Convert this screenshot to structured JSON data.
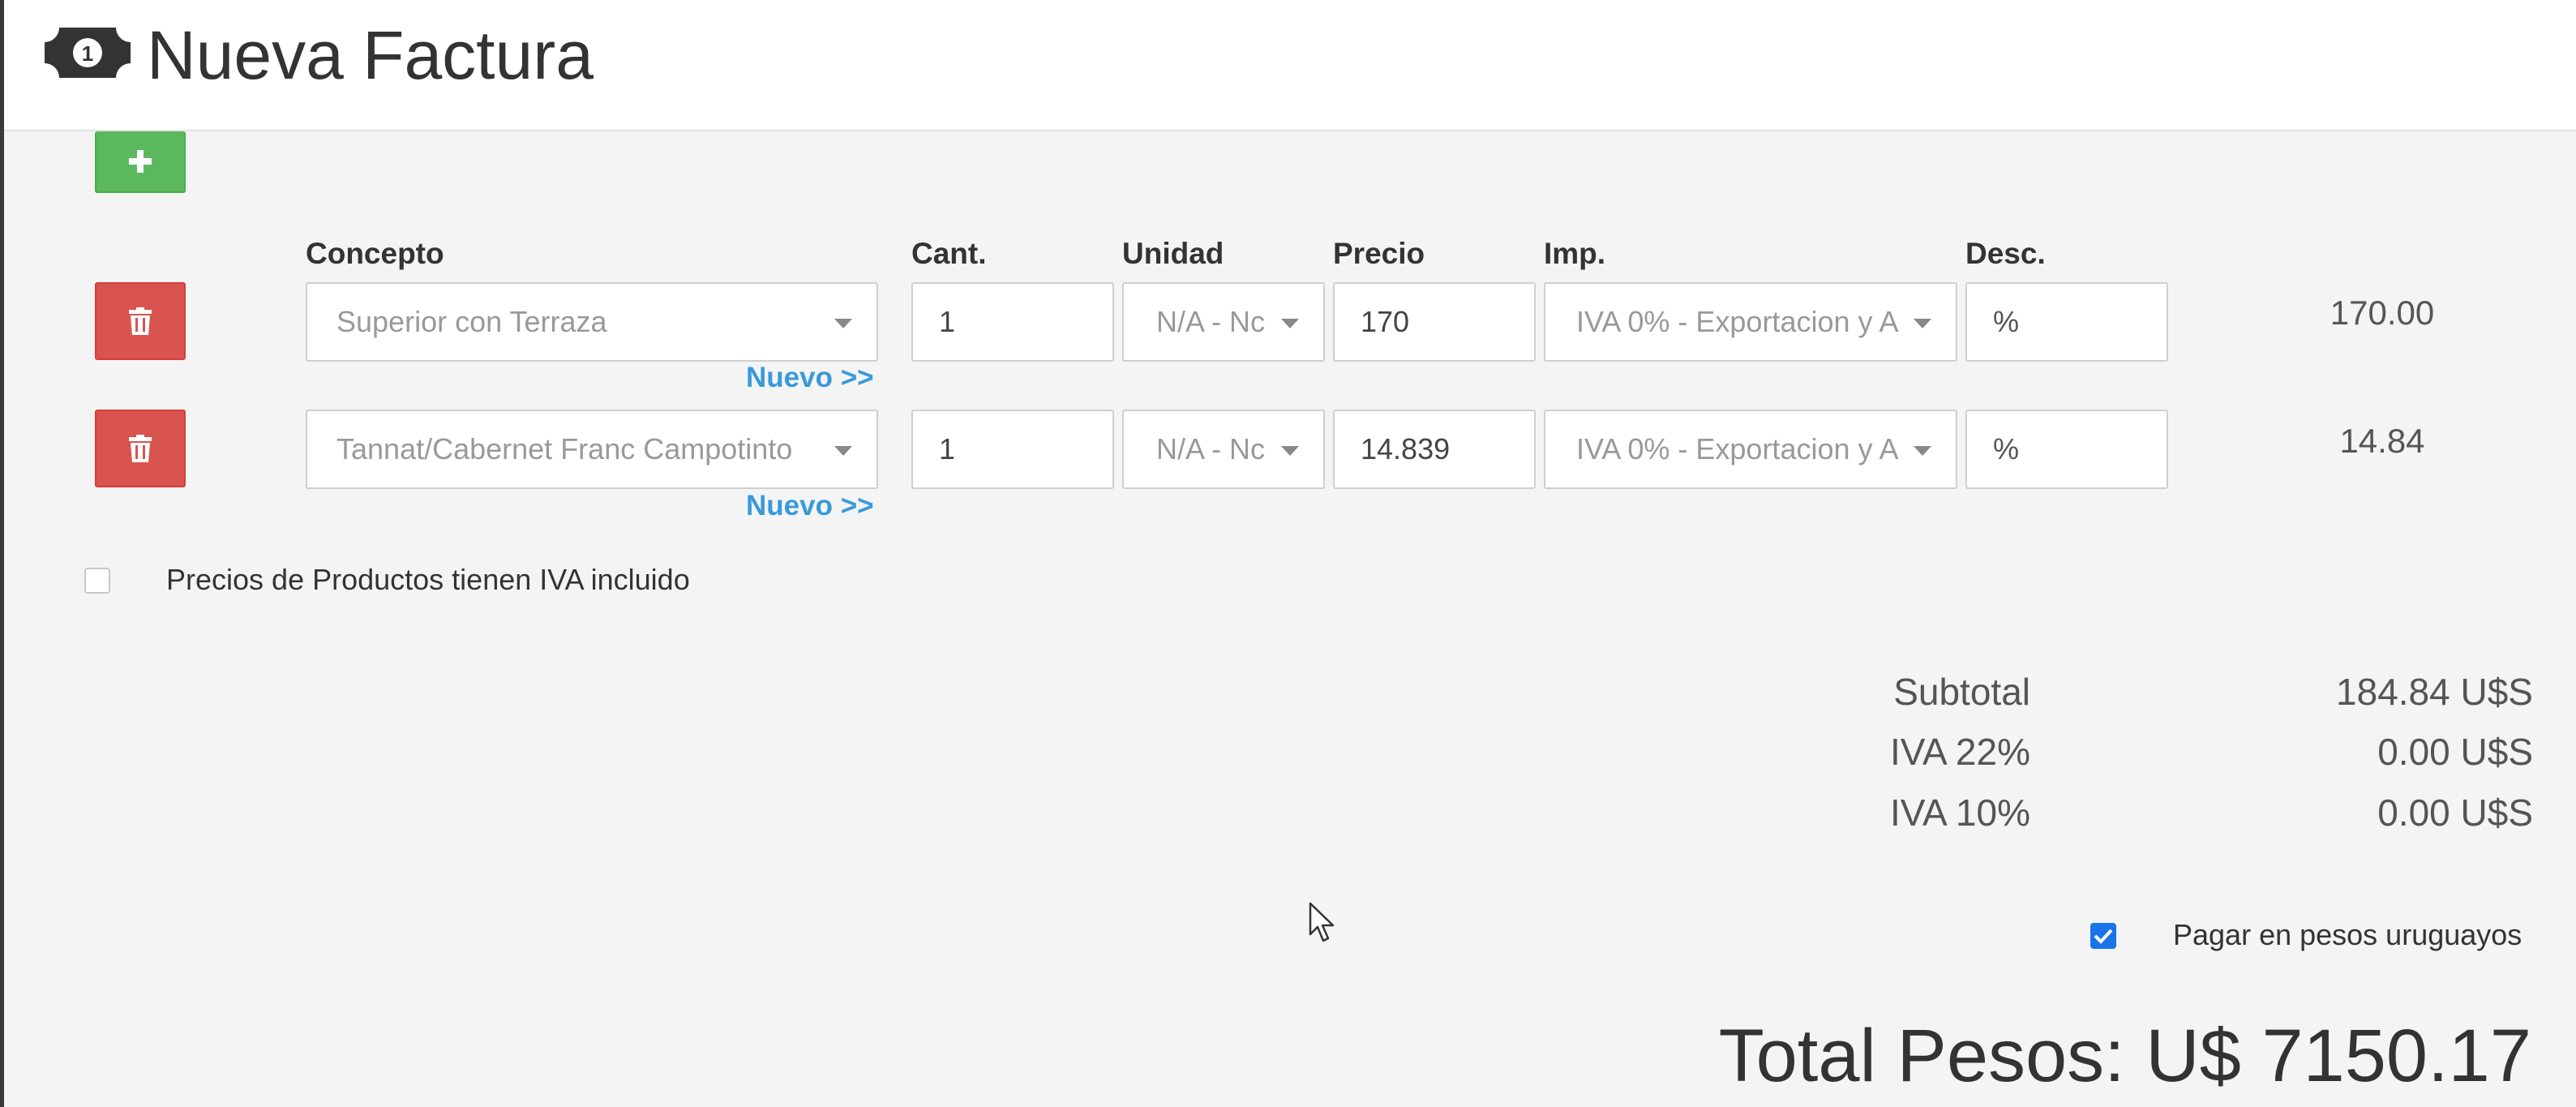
{
  "header": {
    "title": "Nueva Factura",
    "icon": "money-bill-icon"
  },
  "columns": {
    "concepto": "Concepto",
    "cantidad": "Cant.",
    "unidad": "Unidad",
    "precio": "Precio",
    "impuesto": "Imp.",
    "descuento": "Desc."
  },
  "lines": [
    {
      "concepto": "Superior con Terraza",
      "cantidad": "1",
      "unidad": "N/A - Nc",
      "precio": "170",
      "impuesto": "IVA 0% - Exportacion y A",
      "descuento": "%",
      "nuevo_link": "Nuevo >>",
      "total": "170.00"
    },
    {
      "concepto": "Tannat/Cabernet Franc Campotinto",
      "cantidad": "1",
      "unidad": "N/A - Nc",
      "precio": "14.839",
      "impuesto": "IVA 0% - Exportacion y A",
      "descuento": "%",
      "nuevo_link": "Nuevo >>",
      "total": "14.84"
    }
  ],
  "iva_incluido": {
    "label": "Precios de Productos tienen IVA incluido",
    "checked": false
  },
  "summary": {
    "subtotal_label": "Subtotal",
    "subtotal_value": "184.84 U$S",
    "iva22_label": "IVA 22%",
    "iva22_value": "0.00 U$S",
    "iva10_label": "IVA 10%",
    "iva10_value": "0.00 U$S"
  },
  "pagar_pesos": {
    "label": "Pagar en pesos uruguayos",
    "checked": true
  },
  "total": "Total Pesos: U$ 7150.17",
  "colors": {
    "add": "#5cb85c",
    "delete": "#d9534f",
    "link": "#3a9ad9",
    "checkbox": "#1a73e8"
  }
}
